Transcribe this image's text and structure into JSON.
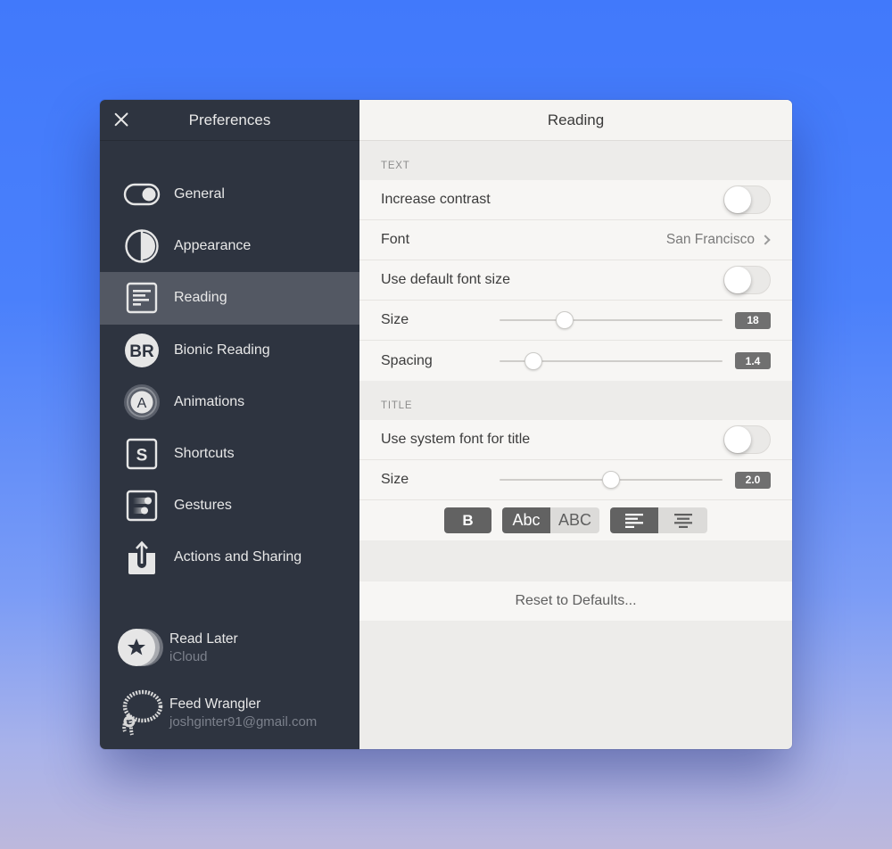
{
  "sidebar": {
    "title": "Preferences",
    "close_icon": "close-icon",
    "items": [
      {
        "id": "general",
        "label": "General",
        "icon": "toggle-icon",
        "active": false
      },
      {
        "id": "appearance",
        "label": "Appearance",
        "icon": "half-circle-icon",
        "active": false
      },
      {
        "id": "reading",
        "label": "Reading",
        "icon": "text-lines-icon",
        "active": true
      },
      {
        "id": "bionic-reading",
        "label": "Bionic Reading",
        "icon": "br-badge-icon",
        "icon_text": "BR",
        "active": false
      },
      {
        "id": "animations",
        "label": "Animations",
        "icon": "animation-a-icon",
        "icon_text": "A",
        "active": false
      },
      {
        "id": "shortcuts",
        "label": "Shortcuts",
        "icon": "shortcut-s-icon",
        "icon_text": "S",
        "active": false
      },
      {
        "id": "gestures",
        "label": "Gestures",
        "icon": "gestures-icon",
        "active": false
      },
      {
        "id": "actions-and-sharing",
        "label": "Actions and Sharing",
        "icon": "share-icon",
        "active": false
      }
    ],
    "accounts": [
      {
        "name": "Read Later",
        "detail": "iCloud",
        "icon": "star-stack-icon"
      },
      {
        "name": "Feed Wrangler",
        "detail": "joshginter91@gmail.com",
        "icon": "lasso-icon"
      }
    ]
  },
  "main": {
    "title": "Reading",
    "sections": {
      "text": {
        "header": "TEXT",
        "increase_contrast": {
          "label": "Increase contrast",
          "on": false
        },
        "font": {
          "label": "Font",
          "value": "San Francisco"
        },
        "use_default_font_size": {
          "label": "Use default font size",
          "on": false
        },
        "size": {
          "label": "Size",
          "value": "18",
          "slider_fraction": 0.29
        },
        "spacing": {
          "label": "Spacing",
          "value": "1.4",
          "slider_fraction": 0.15
        }
      },
      "title": {
        "header": "TITLE",
        "use_system_font": {
          "label": "Use system font for title",
          "on": false
        },
        "size": {
          "label": "Size",
          "value": "2.0",
          "slider_fraction": 0.5
        },
        "format": {
          "bold": {
            "label": "B",
            "on": true
          },
          "case": [
            {
              "label": "Abc",
              "on": true
            },
            {
              "label": "ABC",
              "on": false
            }
          ],
          "alignment": [
            {
              "id": "left",
              "icon": "align-left-icon",
              "on": true
            },
            {
              "id": "center",
              "icon": "align-center-icon",
              "on": false
            }
          ]
        }
      }
    },
    "reset_label": "Reset to Defaults..."
  },
  "colors": {
    "sidebar_bg": "#2e3440",
    "sidebar_active": "#535863",
    "panel_bg": "#edecea",
    "row_bg": "#f7f6f4",
    "segment_on": "#626262",
    "badge_bg": "#707070",
    "desktop_blue": "#4179fb"
  }
}
